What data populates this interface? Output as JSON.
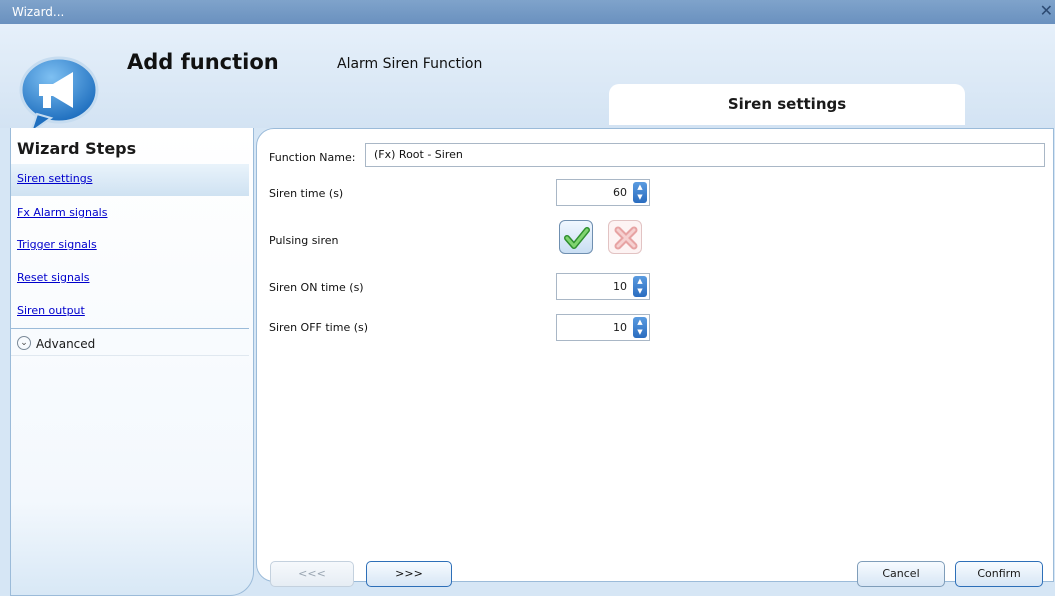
{
  "window": {
    "title": "Wizard...",
    "close_symbol": "✕"
  },
  "header": {
    "title": "Add function",
    "subtitle": "Alarm Siren Function",
    "active_tab": "Siren settings",
    "icon": "megaphone-icon"
  },
  "sidebar": {
    "title": "Wizard Steps",
    "items": [
      {
        "label": "Siren settings",
        "active": true
      },
      {
        "label": "Fx Alarm signals",
        "active": false
      },
      {
        "label": "Trigger signals",
        "active": false
      },
      {
        "label": "Reset signals",
        "active": false
      },
      {
        "label": "Siren output",
        "active": false
      }
    ],
    "advanced_label": "Advanced"
  },
  "form": {
    "function_name_label": "Function Name:",
    "function_name_value": "(Fx) Root - Siren",
    "siren_time_label": "Siren time (s)",
    "siren_time_value": "60",
    "pulsing_label": "Pulsing siren",
    "pulsing_enabled": true,
    "on_time_label": "Siren ON time (s)",
    "on_time_value": "10",
    "off_time_label": "Siren OFF time (s)",
    "off_time_value": "10"
  },
  "footer": {
    "prev_label": "<<<",
    "next_label": ">>>",
    "cancel_label": "Cancel",
    "confirm_label": "Confirm"
  },
  "colors": {
    "link": "#0000cc",
    "titlebar": "#7fa3cb",
    "panel_bg": "#d6e6f5",
    "check_green": "#3ca23c",
    "cross_red": "#e89a9a"
  }
}
